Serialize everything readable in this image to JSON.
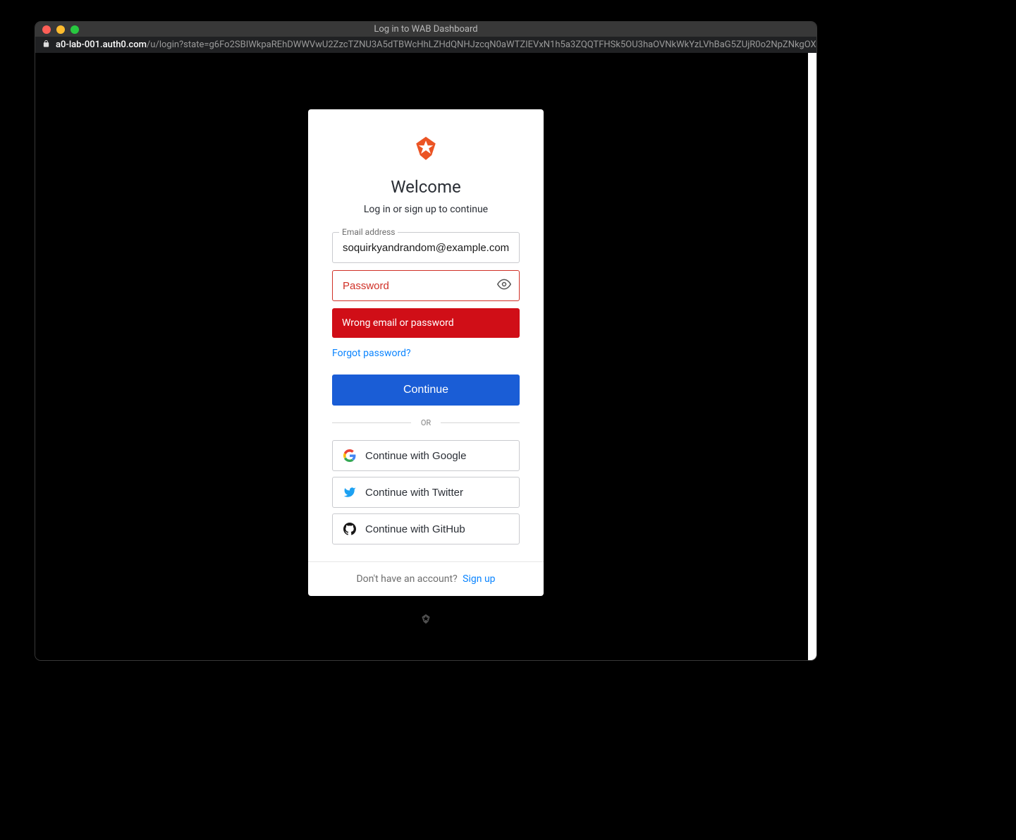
{
  "window": {
    "title": "Log in to WAB Dashboard"
  },
  "url": {
    "domain": "a0-lab-001.auth0.com",
    "path": "/u/login?state=g6Fo2SBIWkpaREhDWWVwU2ZzcTZNU3A5dTBWcHhLZHdQNHJzcqN0aWTZIEVxN1h5a3ZQQTFHSk5OU3haOVNkWkYzLVhBaG5ZUjR0o2NpZNkgOXlTcz…"
  },
  "card": {
    "title": "Welcome",
    "subtitle": "Log in or sign up to continue",
    "email_label": "Email address",
    "email_value": "soquirkyandrandom@example.com",
    "password_placeholder": "Password",
    "error_message": "Wrong email or password",
    "forgot_label": "Forgot password?",
    "continue_label": "Continue",
    "divider_label": "OR",
    "social": {
      "google": "Continue with Google",
      "twitter": "Continue with Twitter",
      "github": "Continue with GitHub"
    },
    "footer_prompt": "Don't have an account?",
    "signup_label": "Sign up"
  },
  "colors": {
    "accent": "#eb5424",
    "primary": "#1a5dd6",
    "error": "#d00e17",
    "link": "#0a84ff"
  }
}
